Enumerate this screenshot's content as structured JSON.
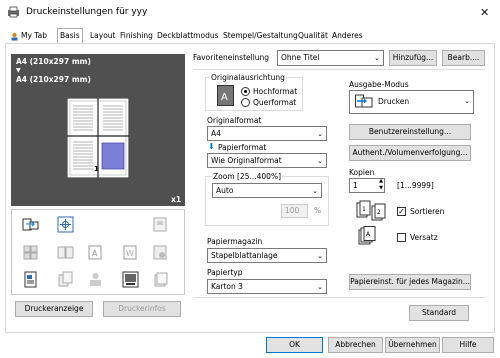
{
  "window": {
    "title": "Druckeinstellungen für yyy",
    "close_glyph": "✕"
  },
  "tabs": [
    {
      "label": "My Tab"
    },
    {
      "label": "Basis"
    },
    {
      "label": "Layout"
    },
    {
      "label": "Finishing"
    },
    {
      "label": "Deckblattmodus"
    },
    {
      "label": "Stempel/Gestaltung"
    },
    {
      "label": "Qualität"
    },
    {
      "label": "Anderes"
    }
  ],
  "preview": {
    "orig_size": "A4 (210x297 mm)",
    "arrow": "▼",
    "paper_size": "A4 (210x297 mm)",
    "copies_badge": "x1",
    "page_number": "1"
  },
  "left_buttons": {
    "printer_view": "Druckeranzeige",
    "printer_info": "Druckerinfos"
  },
  "favorites": {
    "label": "Favoriteneinstellung",
    "value": "Ohne Titel",
    "add_label": "Hinzufüg...",
    "edit_label": "Bearb...."
  },
  "orientation": {
    "label": "Originalausrichtung",
    "portrait": "Hochformat",
    "landscape": "Querformat",
    "selected": "portrait"
  },
  "original_size": {
    "label": "Originalformat",
    "value": "A4"
  },
  "paper_size": {
    "label": "Papierformat",
    "value": "Wie Originalformat"
  },
  "zoom": {
    "label": "Zoom [25...400%]",
    "value": "Auto",
    "percent_value": "100",
    "percent_unit": "%"
  },
  "paper_tray": {
    "label": "Papiermagazin",
    "value": "Stapelblattanlage"
  },
  "paper_type": {
    "label": "Papiertyp",
    "value": "Karton 3"
  },
  "output_mode": {
    "label": "Ausgabe-Modus",
    "value": "Drucken"
  },
  "right_buttons": {
    "user_settings": "Benutzereinstellung...",
    "auth_tracking": "Authent./Volumenverfolgung...",
    "paper_per_tray": "Papiereinst. für jedes Magazin...",
    "standard": "Standard"
  },
  "copies": {
    "label": "Kopien",
    "value": "1",
    "range": "[1...9999]",
    "collate_label": "Sortieren",
    "collate_checked": true,
    "offset_label": "Versatz",
    "offset_checked": false
  },
  "footer": {
    "ok": "OK",
    "cancel": "Abbrechen",
    "apply": "Übernehmen",
    "help": "Hilfe"
  },
  "colors": {
    "accent": "#0078d7",
    "preview_bg": "#505050",
    "button_bg": "#e1e1e1"
  }
}
